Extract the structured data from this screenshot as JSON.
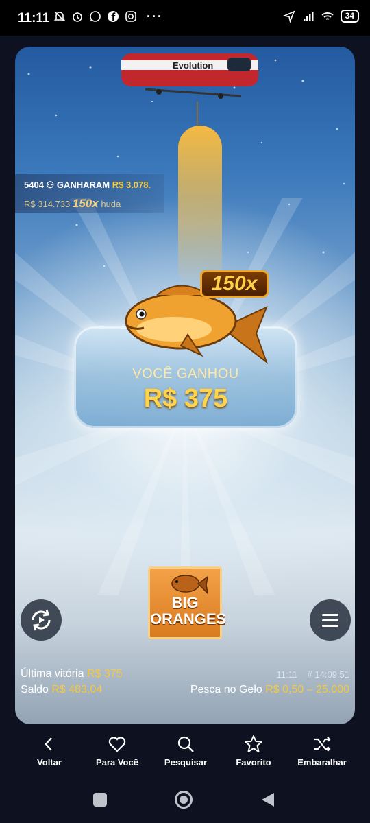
{
  "status_bar": {
    "time": "11:11",
    "dots": "···",
    "battery": "34"
  },
  "game": {
    "brand": "Evolution",
    "feed": {
      "players": "5404",
      "ganharam_label": "GANHARAM",
      "ganharam_amount": "R$ 3.078.",
      "pool": "R$ 314.733",
      "multiplier": "150x",
      "user": "huda"
    },
    "multiplier_badge": "150x",
    "win_title": "VOCÊ GANHOU",
    "win_amount": "R$ 375",
    "logo_text_line1": "BIG",
    "logo_text_line2": "ORANGES",
    "last_win_label": "Última vitória",
    "last_win_value": "R$ 375",
    "balance_label": "Saldo",
    "balance_value": "R$ 483,04",
    "clock": "11:11",
    "round_id": "# 14:09:51",
    "game_name": "Pesca no Gelo",
    "bet_range": "R$ 0,50 – 25.000"
  },
  "bottom_nav": [
    {
      "label": "Voltar",
      "icon": "chevron-left-icon"
    },
    {
      "label": "Para Você",
      "icon": "heart-icon"
    },
    {
      "label": "Pesquisar",
      "icon": "search-icon"
    },
    {
      "label": "Favorito",
      "icon": "star-icon"
    },
    {
      "label": "Embaralhar",
      "icon": "shuffle-icon"
    }
  ],
  "colors": {
    "accent_yellow": "#f6c83d",
    "background": "#0e1220"
  }
}
